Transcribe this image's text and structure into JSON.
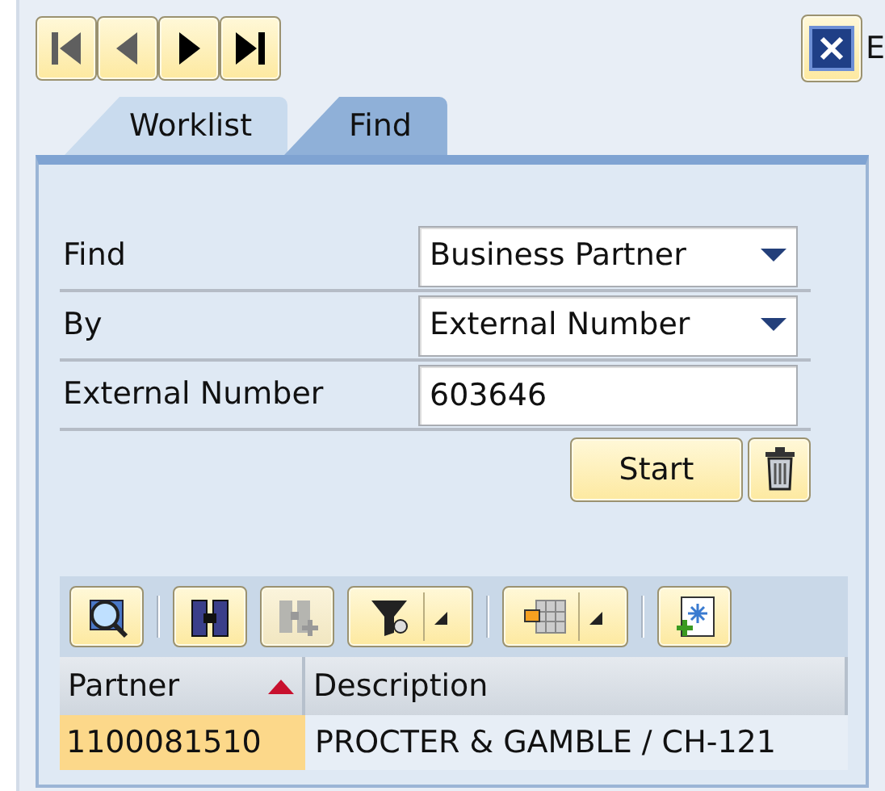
{
  "nav_buttons": [
    {
      "kind": "first",
      "disabled": true
    },
    {
      "kind": "previous",
      "disabled": true
    },
    {
      "kind": "next",
      "disabled": false
    },
    {
      "kind": "last",
      "disabled": false
    }
  ],
  "close_label": "E",
  "tabs": [
    {
      "label": "Worklist",
      "selected": false
    },
    {
      "label": "Find",
      "selected": true
    }
  ],
  "form": [
    {
      "label": "Find",
      "kind": "dropdown",
      "value": "Business Partner"
    },
    {
      "label": "By",
      "kind": "dropdown",
      "value": "External Number"
    },
    {
      "label": "External Number",
      "kind": "input",
      "value": "603646"
    }
  ],
  "start_button": "Start",
  "toolbar": [
    {
      "kind": "button",
      "disabled": false
    },
    {
      "kind": "separator"
    },
    {
      "kind": "button",
      "disabled": false
    },
    {
      "kind": "button",
      "disabled": true
    },
    {
      "kind": "split",
      "disabled": false
    },
    {
      "kind": "separator"
    },
    {
      "kind": "split",
      "disabled": false
    },
    {
      "kind": "separator"
    },
    {
      "kind": "button",
      "disabled": false
    }
  ],
  "table": {
    "columns": [
      {
        "label": "Partner",
        "sorted": true
      },
      {
        "label": "Description",
        "sorted": false
      }
    ],
    "rows": [
      {
        "cells": [
          "1100081510",
          "PROCTER & GAMBLE / CH-121"
        ],
        "selected": true
      }
    ]
  }
}
